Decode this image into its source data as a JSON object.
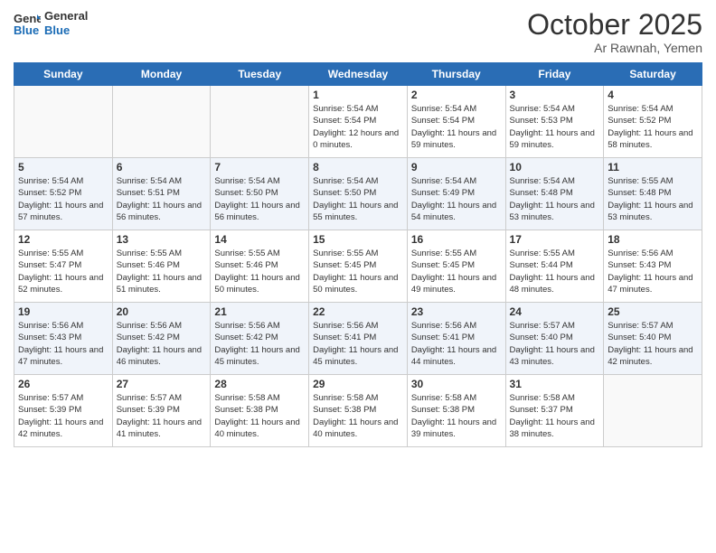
{
  "header": {
    "logo_line1": "General",
    "logo_line2": "Blue",
    "month": "October 2025",
    "location": "Ar Rawnah, Yemen"
  },
  "days_of_week": [
    "Sunday",
    "Monday",
    "Tuesday",
    "Wednesday",
    "Thursday",
    "Friday",
    "Saturday"
  ],
  "weeks": [
    [
      {
        "day": "",
        "info": ""
      },
      {
        "day": "",
        "info": ""
      },
      {
        "day": "",
        "info": ""
      },
      {
        "day": "1",
        "info": "Sunrise: 5:54 AM\nSunset: 5:54 PM\nDaylight: 12 hours and 0 minutes."
      },
      {
        "day": "2",
        "info": "Sunrise: 5:54 AM\nSunset: 5:54 PM\nDaylight: 11 hours and 59 minutes."
      },
      {
        "day": "3",
        "info": "Sunrise: 5:54 AM\nSunset: 5:53 PM\nDaylight: 11 hours and 59 minutes."
      },
      {
        "day": "4",
        "info": "Sunrise: 5:54 AM\nSunset: 5:52 PM\nDaylight: 11 hours and 58 minutes."
      }
    ],
    [
      {
        "day": "5",
        "info": "Sunrise: 5:54 AM\nSunset: 5:52 PM\nDaylight: 11 hours and 57 minutes."
      },
      {
        "day": "6",
        "info": "Sunrise: 5:54 AM\nSunset: 5:51 PM\nDaylight: 11 hours and 56 minutes."
      },
      {
        "day": "7",
        "info": "Sunrise: 5:54 AM\nSunset: 5:50 PM\nDaylight: 11 hours and 56 minutes."
      },
      {
        "day": "8",
        "info": "Sunrise: 5:54 AM\nSunset: 5:50 PM\nDaylight: 11 hours and 55 minutes."
      },
      {
        "day": "9",
        "info": "Sunrise: 5:54 AM\nSunset: 5:49 PM\nDaylight: 11 hours and 54 minutes."
      },
      {
        "day": "10",
        "info": "Sunrise: 5:54 AM\nSunset: 5:48 PM\nDaylight: 11 hours and 53 minutes."
      },
      {
        "day": "11",
        "info": "Sunrise: 5:55 AM\nSunset: 5:48 PM\nDaylight: 11 hours and 53 minutes."
      }
    ],
    [
      {
        "day": "12",
        "info": "Sunrise: 5:55 AM\nSunset: 5:47 PM\nDaylight: 11 hours and 52 minutes."
      },
      {
        "day": "13",
        "info": "Sunrise: 5:55 AM\nSunset: 5:46 PM\nDaylight: 11 hours and 51 minutes."
      },
      {
        "day": "14",
        "info": "Sunrise: 5:55 AM\nSunset: 5:46 PM\nDaylight: 11 hours and 50 minutes."
      },
      {
        "day": "15",
        "info": "Sunrise: 5:55 AM\nSunset: 5:45 PM\nDaylight: 11 hours and 50 minutes."
      },
      {
        "day": "16",
        "info": "Sunrise: 5:55 AM\nSunset: 5:45 PM\nDaylight: 11 hours and 49 minutes."
      },
      {
        "day": "17",
        "info": "Sunrise: 5:55 AM\nSunset: 5:44 PM\nDaylight: 11 hours and 48 minutes."
      },
      {
        "day": "18",
        "info": "Sunrise: 5:56 AM\nSunset: 5:43 PM\nDaylight: 11 hours and 47 minutes."
      }
    ],
    [
      {
        "day": "19",
        "info": "Sunrise: 5:56 AM\nSunset: 5:43 PM\nDaylight: 11 hours and 47 minutes."
      },
      {
        "day": "20",
        "info": "Sunrise: 5:56 AM\nSunset: 5:42 PM\nDaylight: 11 hours and 46 minutes."
      },
      {
        "day": "21",
        "info": "Sunrise: 5:56 AM\nSunset: 5:42 PM\nDaylight: 11 hours and 45 minutes."
      },
      {
        "day": "22",
        "info": "Sunrise: 5:56 AM\nSunset: 5:41 PM\nDaylight: 11 hours and 45 minutes."
      },
      {
        "day": "23",
        "info": "Sunrise: 5:56 AM\nSunset: 5:41 PM\nDaylight: 11 hours and 44 minutes."
      },
      {
        "day": "24",
        "info": "Sunrise: 5:57 AM\nSunset: 5:40 PM\nDaylight: 11 hours and 43 minutes."
      },
      {
        "day": "25",
        "info": "Sunrise: 5:57 AM\nSunset: 5:40 PM\nDaylight: 11 hours and 42 minutes."
      }
    ],
    [
      {
        "day": "26",
        "info": "Sunrise: 5:57 AM\nSunset: 5:39 PM\nDaylight: 11 hours and 42 minutes."
      },
      {
        "day": "27",
        "info": "Sunrise: 5:57 AM\nSunset: 5:39 PM\nDaylight: 11 hours and 41 minutes."
      },
      {
        "day": "28",
        "info": "Sunrise: 5:58 AM\nSunset: 5:38 PM\nDaylight: 11 hours and 40 minutes."
      },
      {
        "day": "29",
        "info": "Sunrise: 5:58 AM\nSunset: 5:38 PM\nDaylight: 11 hours and 40 minutes."
      },
      {
        "day": "30",
        "info": "Sunrise: 5:58 AM\nSunset: 5:38 PM\nDaylight: 11 hours and 39 minutes."
      },
      {
        "day": "31",
        "info": "Sunrise: 5:58 AM\nSunset: 5:37 PM\nDaylight: 11 hours and 38 minutes."
      },
      {
        "day": "",
        "info": ""
      }
    ]
  ]
}
